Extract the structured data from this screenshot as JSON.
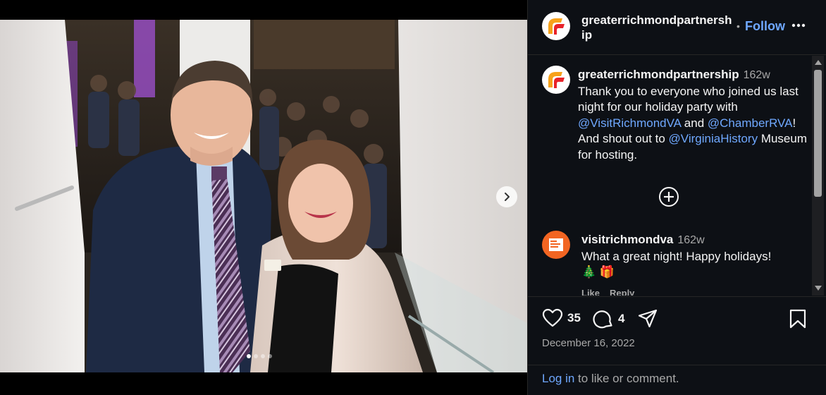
{
  "post": {
    "username": "greaterrichmondpartnership",
    "header_username": "greaterrichmondpartnersh ip",
    "separator": "•",
    "follow_label": "Follow",
    "caption": {
      "username": "greaterrichmondpartnership",
      "age": "162w",
      "text_1": "Thank you to everyone who joined us last night for our holiday party with ",
      "mention_1": "@VisitRichmondVA",
      "text_2": " and ",
      "mention_2": "@ChamberRVA",
      "text_3": "! And shout out to ",
      "mention_3": "@VirginiaHistory",
      "text_4": " Museum for hosting."
    },
    "comments": [
      {
        "username": "visitrichmondva",
        "age": "162w",
        "text": "What a great night! Happy holidays!",
        "emoji": "🎄 🎁",
        "like_label": "Like",
        "reply_label": "Reply"
      }
    ],
    "likes": "35",
    "comment_count": "4",
    "date": "December 16, 2022",
    "login_link": "Log in",
    "login_text": " to like or comment."
  },
  "carousel": {
    "current": 1,
    "total": 4
  },
  "icons": [
    "greater-richmond-logo-icon",
    "more-options-icon",
    "add-circle-icon",
    "heart-icon",
    "comment-icon",
    "share-icon",
    "bookmark-icon",
    "chevron-right-icon"
  ],
  "colors": {
    "accent": "#6fa8ff",
    "panel_bg": "#0d1015",
    "muted": "#a8a8a8",
    "brand_orange": "#f26522"
  }
}
